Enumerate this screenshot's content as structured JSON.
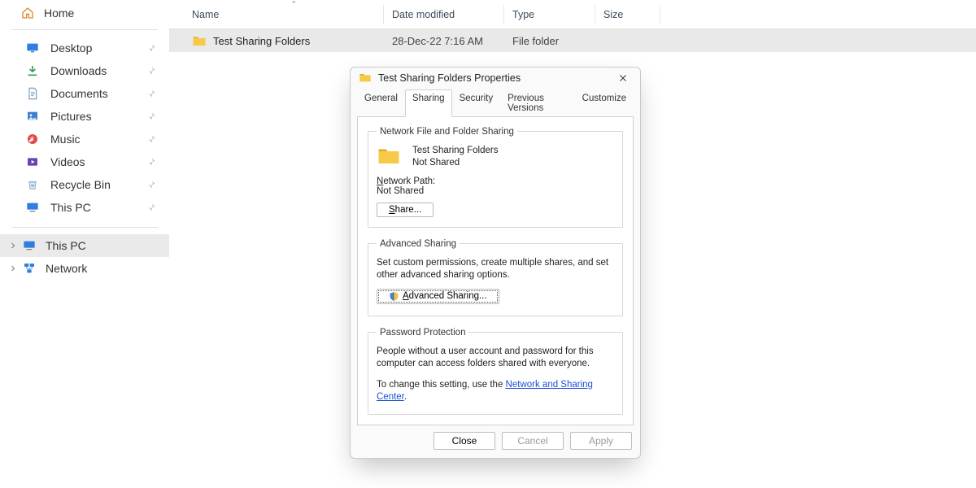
{
  "sidebar": {
    "home": "Home",
    "items": [
      {
        "label": "Desktop"
      },
      {
        "label": "Downloads"
      },
      {
        "label": "Documents"
      },
      {
        "label": "Pictures"
      },
      {
        "label": "Music"
      },
      {
        "label": "Videos"
      },
      {
        "label": "Recycle Bin"
      },
      {
        "label": "This PC"
      }
    ],
    "tree": [
      {
        "label": "This PC"
      },
      {
        "label": "Network"
      }
    ]
  },
  "columns": {
    "name": "Name",
    "date": "Date modified",
    "type": "Type",
    "size": "Size"
  },
  "rows": [
    {
      "name": "Test Sharing Folders",
      "date": "28-Dec-22 7:16 AM",
      "type": "File folder",
      "size": ""
    }
  ],
  "dialog": {
    "title": "Test Sharing Folders Properties",
    "tabs": {
      "general": "General",
      "sharing": "Sharing",
      "security": "Security",
      "previous": "Previous Versions",
      "customize": "Customize"
    },
    "group1": {
      "legend": "Network File and Folder Sharing",
      "folder_name": "Test Sharing Folders",
      "share_state": "Not Shared",
      "np_label_pre": "N",
      "np_label_post": "etwork Path:",
      "np_value": "Not Shared",
      "share_btn_pre": "S",
      "share_btn_post": "hare..."
    },
    "group2": {
      "legend": "Advanced Sharing",
      "desc": "Set custom permissions, create multiple shares, and set other advanced sharing options.",
      "btn_pre": "A",
      "btn_post": "dvanced Sharing..."
    },
    "group3": {
      "legend": "Password Protection",
      "desc": "People without a user account and password for this computer can access folders shared with everyone.",
      "link_pre": "To change this setting, use the ",
      "link_text": "Network and Sharing Center",
      "link_post": "."
    },
    "buttons": {
      "close": "Close",
      "cancel": "Cancel",
      "apply": "Apply"
    }
  }
}
